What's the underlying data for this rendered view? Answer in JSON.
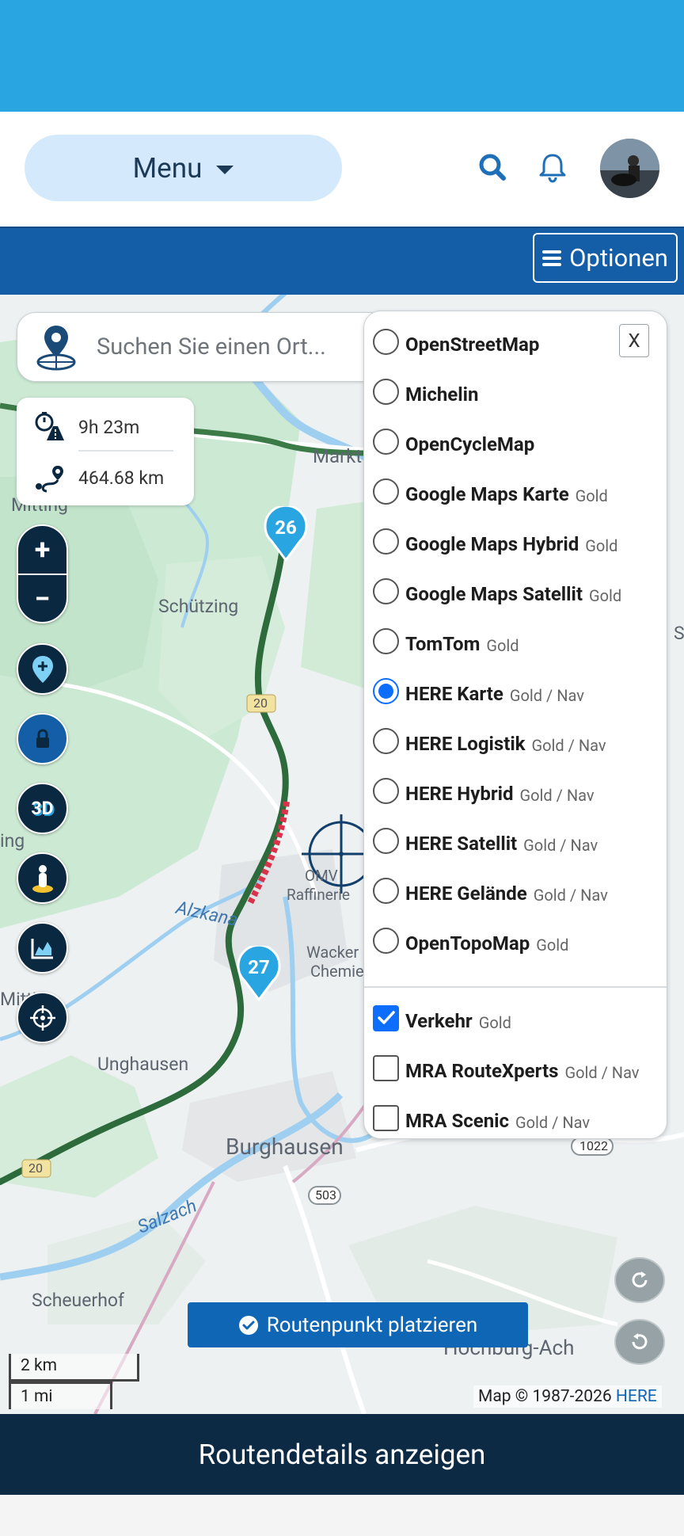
{
  "header": {
    "menu_label": "Menu",
    "search_icon": "search-icon",
    "bell_icon": "bell-icon",
    "avatar": "user-avatar"
  },
  "toolbar": {
    "options_label": "Optionen"
  },
  "map": {
    "search_placeholder": "Suchen Sie einen Ort...",
    "duration": "9h 23m",
    "distance": "464.68 km",
    "place_waypoint_label": "Routenpunkt platzieren",
    "scale_km": "2 km",
    "scale_mi": "1 mi",
    "attribution_prefix": "Map © 1987-2026 ",
    "attribution_link": "HERE",
    "zoom_in": "+",
    "zoom_out": "−",
    "three_d_label": "3D",
    "markers": [
      "26",
      "27"
    ],
    "place_labels": {
      "markt": "Markt",
      "mitting1": "Mitting",
      "schutzing": "Schützing",
      "ing": "ing",
      "omv": "OMV",
      "raffinerie": "Raffinerie",
      "alzkanal": "Alzkana",
      "wacker": "Wacker",
      "chemie": "Chemie",
      "mitting2": "Mitting",
      "unghausen": "Unghausen",
      "burghausen": "Burghausen",
      "salzach": "Salzach",
      "scheuerhof": "Scheuerhof",
      "hochburg": "Hochburg-Ach",
      "road_503": "503",
      "road_1022": "1022",
      "road_20": "20",
      "s_edge": "S"
    }
  },
  "layers": {
    "close_label": "X",
    "base": [
      {
        "name": "OpenStreetMap",
        "tier": "",
        "selected": false
      },
      {
        "name": "Michelin",
        "tier": "",
        "selected": false
      },
      {
        "name": "OpenCycleMap",
        "tier": "",
        "selected": false
      },
      {
        "name": "Google Maps Karte",
        "tier": "Gold",
        "selected": false
      },
      {
        "name": "Google Maps Hybrid",
        "tier": "Gold",
        "selected": false
      },
      {
        "name": "Google Maps Satellit",
        "tier": "Gold",
        "selected": false
      },
      {
        "name": "TomTom",
        "tier": "Gold",
        "selected": false
      },
      {
        "name": "HERE Karte",
        "tier": "Gold / Nav",
        "selected": true
      },
      {
        "name": "HERE Logistik",
        "tier": "Gold / Nav",
        "selected": false
      },
      {
        "name": "HERE Hybrid",
        "tier": "Gold / Nav",
        "selected": false
      },
      {
        "name": "HERE Satellit",
        "tier": "Gold / Nav",
        "selected": false
      },
      {
        "name": "HERE Gelände",
        "tier": "Gold / Nav",
        "selected": false
      },
      {
        "name": "OpenTopoMap",
        "tier": "Gold",
        "selected": false
      }
    ],
    "overlays": [
      {
        "name": "Verkehr",
        "tier": "Gold",
        "checked": true
      },
      {
        "name": "MRA RouteXperts",
        "tier": "Gold / Nav",
        "checked": false
      },
      {
        "name": "MRA Scenic",
        "tier": "Gold / Nav",
        "checked": false
      }
    ]
  },
  "footer": {
    "route_details_label": "Routendetails anzeigen"
  },
  "colors": {
    "status_bar": "#29a6e1",
    "toolbar": "#135ea6",
    "bottom_bar": "#0d2a44",
    "route": "#2e6b3c",
    "marker": "#29a6e1",
    "accent": "#0d6efd"
  }
}
